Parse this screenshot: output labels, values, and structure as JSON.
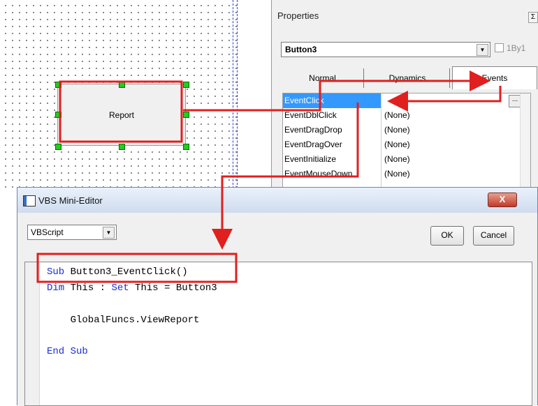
{
  "canvas": {
    "button_label": "Report"
  },
  "properties": {
    "title": "Properties",
    "close_glyph": "Σ",
    "object_selector": {
      "value": "Button3"
    },
    "checkbox_label": "1By1",
    "tabs": [
      {
        "label": "Normal"
      },
      {
        "label": "Dynamics"
      },
      {
        "label": "Events"
      }
    ],
    "events": [
      {
        "name": "EventClick",
        "value": ""
      },
      {
        "name": "EventDblClick",
        "value": "(None)"
      },
      {
        "name": "EventDragDrop",
        "value": "(None)"
      },
      {
        "name": "EventDragOver",
        "value": "(None)"
      },
      {
        "name": "EventInitialize",
        "value": "(None)"
      },
      {
        "name": "EventMouseDown",
        "value": "(None)"
      }
    ],
    "ellipsis_label": "..."
  },
  "editor": {
    "title": "VBS Mini-Editor",
    "close_label": "X",
    "language": "VBScript",
    "ok_label": "OK",
    "cancel_label": "Cancel",
    "code": {
      "line1_kw": "Sub",
      "line1_rest": " Button3_EventClick()",
      "line2_kw1": "Dim",
      "line2_mid": " This : ",
      "line2_kw2": "Set",
      "line2_rest": " This = Button3",
      "line3": "    GlobalFuncs.ViewReport",
      "line4": "End Sub"
    }
  },
  "colors": {
    "annotation": "#e01f1f",
    "selection": "#3399ff",
    "keyword": "#1a2fd4",
    "handle": "#22cc22"
  }
}
